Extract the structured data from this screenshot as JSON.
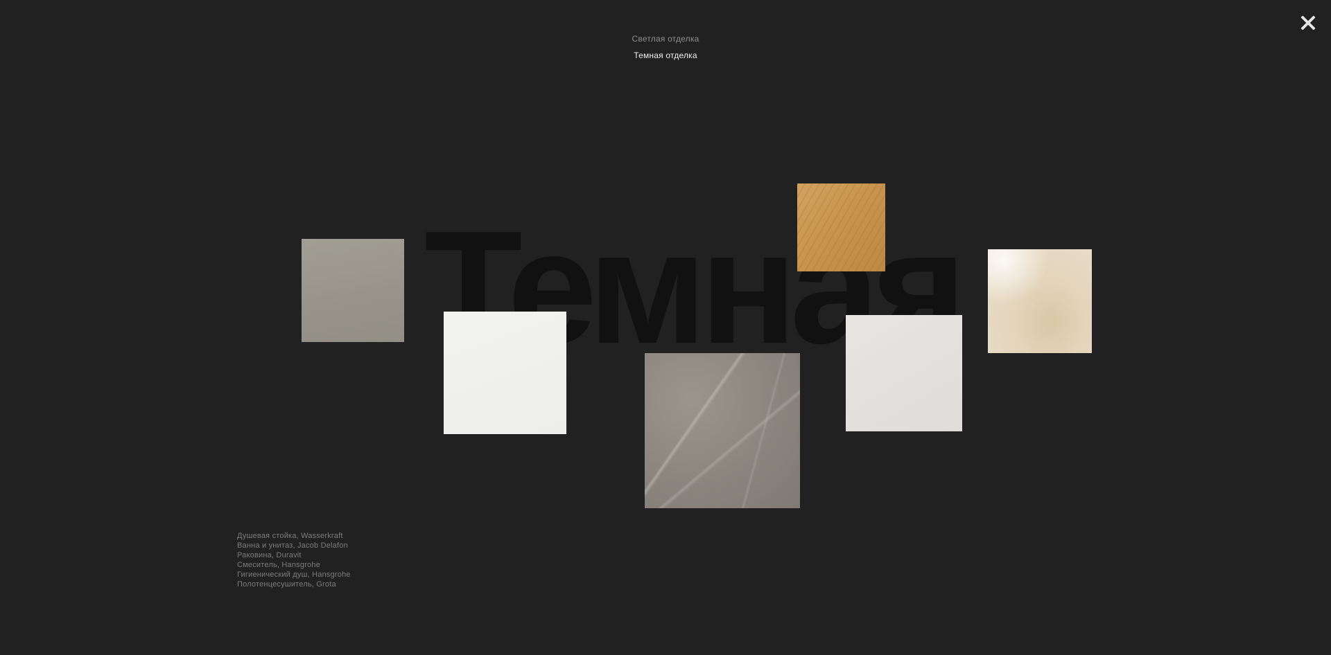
{
  "variants": {
    "items": [
      {
        "label": "Светлая отделка",
        "active": false
      },
      {
        "label": "Темная отделка",
        "active": true
      }
    ]
  },
  "heading": {
    "text": "Темная"
  },
  "swatches": [
    {
      "name": "taupe-tile",
      "color": "#97938a"
    },
    {
      "name": "white-tile",
      "color": "#efefee"
    },
    {
      "name": "grey-marble-tile",
      "color": "#8b857e"
    },
    {
      "name": "oak-wood",
      "color": "#c7954f"
    },
    {
      "name": "light-grey-tile",
      "color": "#e3e1dd"
    },
    {
      "name": "beige-marble-tile",
      "color": "#e3d4bb"
    }
  ],
  "products": [
    "Душевая стойка, Wasserkraft",
    "Ванна и унитаз, Jacob Delafon",
    "Раковина, Duravit",
    "Смеситель, Hansgrohe",
    "Гигиенический душ, Hansgrohe",
    "Полотенцесушитель, Grota"
  ],
  "colors": {
    "background": "#212121",
    "heading": "#111111",
    "tab_inactive": "#8f8f8f",
    "tab_active": "#f0f0f0",
    "list_text": "#7d7d7d"
  },
  "icons": {
    "close": "close-icon"
  }
}
